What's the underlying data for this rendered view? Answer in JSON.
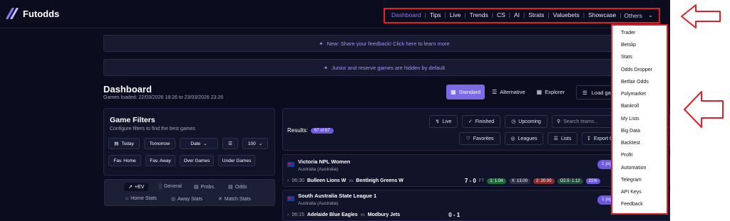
{
  "app": {
    "title": "Futodds"
  },
  "nav": {
    "items": [
      "Dashboard",
      "Tips",
      "Live",
      "Trends",
      "CS",
      "AI",
      "Strats",
      "Valuebets",
      "Showcase"
    ],
    "active": "Dashboard",
    "others_label": "Others"
  },
  "banners": {
    "feedback": "New: Share your feedback! Click here to learn more",
    "junior": "Junior and reserve games are hidden by default"
  },
  "dashboard": {
    "title": "Dashboard",
    "games_loaded": "Games loaded: 22/03/2026 18:26 to 23/03/2026 23:26",
    "view_tabs": [
      "Standard",
      "Alternative",
      "Explorer"
    ],
    "load_label": "Load ga"
  },
  "filters": {
    "title": "Game Filters",
    "subtitle": "Configure filters to find the best games",
    "row1": {
      "today": "Today",
      "tomorrow": "Tomorrow",
      "date": "Date",
      "count": "100"
    },
    "row2": [
      "Fav. Home",
      "Fav. Away",
      "Over Games",
      "Under Games"
    ]
  },
  "stats_tabs": {
    "row1": [
      "+EV",
      "General",
      "Probs.",
      "Odds"
    ],
    "row2": [
      "Home Stats",
      "Away Stats",
      "Match Stats"
    ]
  },
  "results": {
    "label": "Results:",
    "count": "67 of 67",
    "buttons_row1": [
      "Live",
      "Finished",
      "Upcoming"
    ],
    "search_placeholder": "Search teams...",
    "buttons_row2": [
      "Favorites",
      "Leagues",
      "Lists",
      "Export C"
    ]
  },
  "matches": [
    {
      "league": "Victoria NPL Women",
      "country": "Australia (Australia)",
      "time": "06:30",
      "home": "Bulleen Lions W",
      "vs": "vs",
      "away": "Bentleigh Greens W",
      "score": "7 - 0",
      "status": "FT",
      "odds1": "1: 1.04",
      "oddsx": "X: 13.00",
      "odds2": "2: 20.00",
      "o25": "O2.5: 1.12",
      "pct": "21%",
      "jpill": "1 jog"
    },
    {
      "league": "South Australia State League 1",
      "country": "Australia (Australia)",
      "time": "06:15",
      "home": "Adelaide Blue Eagles",
      "vs": "vs",
      "away": "Modbury Jets",
      "score": "0 - 1",
      "status": "",
      "jpill": "1 jog"
    }
  ],
  "others_menu": [
    "Trader",
    "Betslip",
    "Stats",
    "Odds Dropper",
    "Betfair Odds",
    "Polymarket",
    "Bankroll",
    "My Lists",
    "Big Data",
    "Backtest",
    "Profit",
    "Automation",
    "Telegram",
    "API Keys",
    "Feedback"
  ],
  "colors": {
    "accent": "#7b69e8",
    "highlight": "#e22028",
    "background": "#0b0d1e"
  }
}
